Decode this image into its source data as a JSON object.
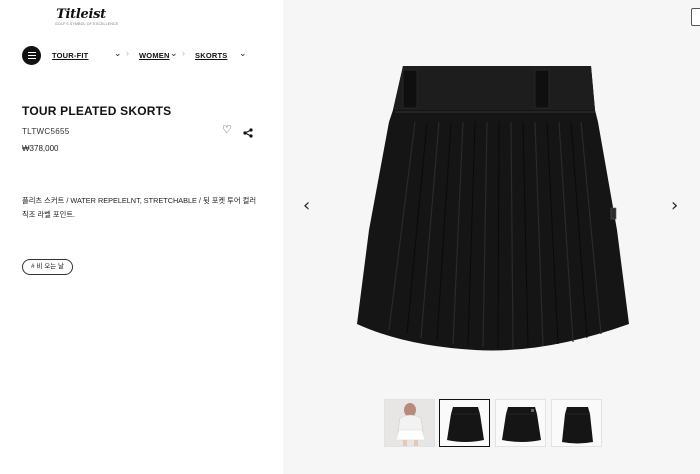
{
  "brand": {
    "name": "Titleist",
    "tagline": "GOLF'S SYMBOL OF EXCELLENCE"
  },
  "breadcrumb": {
    "items": [
      {
        "label": "TOUR-FIT"
      },
      {
        "label": "WOMEN"
      },
      {
        "label": "SKORTS"
      }
    ]
  },
  "product": {
    "title": "TOUR PLEATED SKORTS",
    "code": "TLTWC5655",
    "price": "₩378,000",
    "description": "플리츠 스커트 / WATER REPELELNT, STRETCHABLE / 뒷 포켓 투어 컬러 직조 라벨 포인트.",
    "tag_button": "# 비 오는 날"
  },
  "gallery": {
    "thumbnails": [
      {
        "kind": "model-photo"
      },
      {
        "kind": "front-view",
        "active": true
      },
      {
        "kind": "side-view"
      },
      {
        "kind": "back-view"
      }
    ]
  },
  "colors": {
    "accent": "#111111",
    "panel_bg": "#f6f6f6",
    "skirt": "#141414"
  }
}
